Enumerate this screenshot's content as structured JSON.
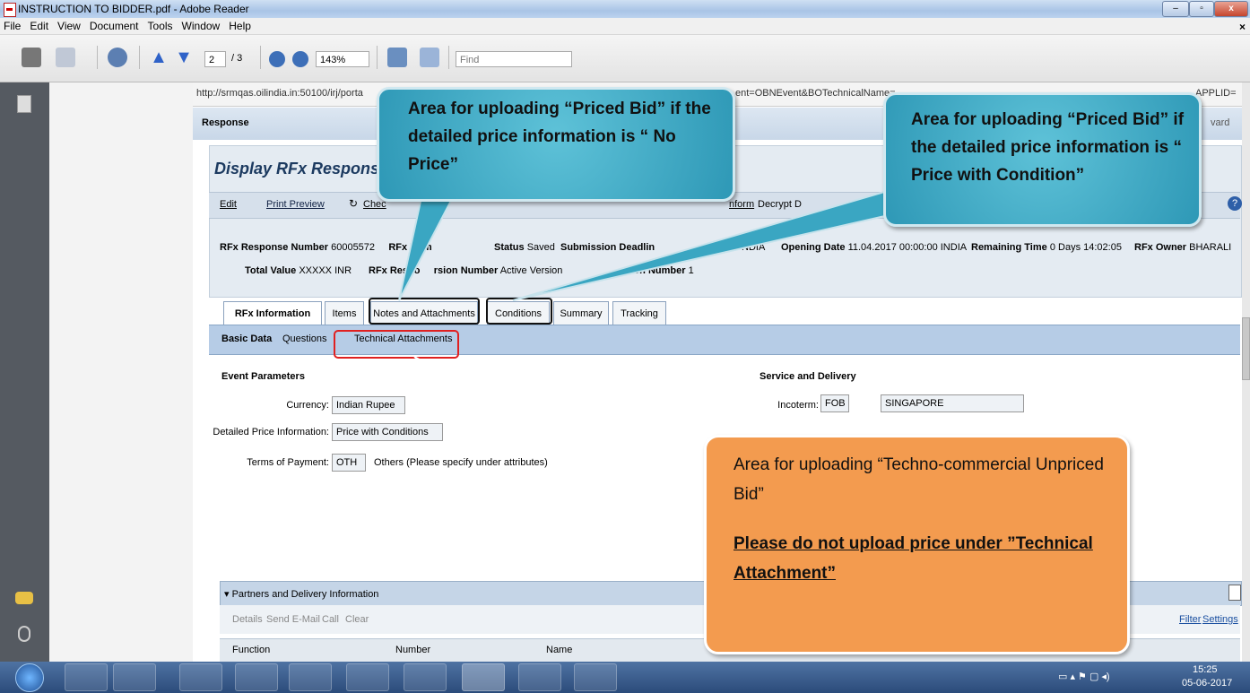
{
  "window": {
    "title": "INSTRUCTION TO BIDDER.pdf - Adobe Reader",
    "min": "–",
    "max": "▫",
    "close": "x"
  },
  "menu": [
    "File",
    "Edit",
    "View",
    "Document",
    "Tools",
    "Window",
    "Help"
  ],
  "menu_close": "×",
  "toolbar": {
    "page_current": "2",
    "page_total": "/ 3",
    "zoom": "143%",
    "find_placeholder": "Find"
  },
  "sap": {
    "url": "http://srmqas.oilindia.in:50100/irj/porta",
    "url_mid": "ent=OBNEvent&BOTechnicalName=",
    "url_right": "APPLID=",
    "response_label": "Response",
    "right_frag": "vard",
    "page_title": "Display RFx Response:",
    "toolbar": {
      "edit": "Edit",
      "print_preview": "Print Preview",
      "check": "Chec",
      "nform": "nform",
      "decrypt": "Decrypt D"
    },
    "header": {
      "response_number_label": "RFx Response Number",
      "response_number": "60005572",
      "rfx_num_label": "RFx Num",
      "status_label": "Status",
      "status": "Saved",
      "submission_label": "Submission Deadlin",
      "india_frag": "NDIA",
      "opening_label": "Opening Date",
      "opening": "11.04.2017 00:00:00 INDIA",
      "remaining_label": "Remaining Time",
      "remaining": "0 Days 14:02:05",
      "owner_label": "RFx Owner",
      "owner": "BHARALI",
      "total_label": "Total Value",
      "total": "XXXXX INR",
      "version_label_a": "RFx Respo",
      "version_label_b": "rsion Number",
      "version": "Active Version",
      "version_num_label": "rsion Number",
      "version_num": "1"
    },
    "tabs": [
      "RFx Information",
      "Items",
      "Notes and Attachments",
      "Conditions",
      "Summary",
      "Tracking"
    ],
    "subtabs": [
      "Basic Data",
      "Questions",
      "Technical Attachments"
    ],
    "event_params": {
      "title": "Event Parameters",
      "currency_label": "Currency:",
      "currency": "Indian Rupee",
      "price_info_label": "Detailed Price Information:",
      "price_info": "Price with Conditions",
      "payment_label": "Terms of Payment:",
      "payment_code": "OTH",
      "payment_text": "Others (Please specify under attributes)"
    },
    "service": {
      "title": "Service and Delivery",
      "incoterm_label": "Incoterm:",
      "incoterm_code": "FOB",
      "incoterm_place": "SINGAPORE"
    },
    "partners": {
      "title": "▾ Partners and Delivery Information",
      "actions": [
        "Details",
        "Send E-Mail",
        "Call",
        "Clear"
      ],
      "filter": "Filter",
      "settings": "Settings",
      "columns": [
        "Function",
        "Number",
        "Name"
      ]
    }
  },
  "callouts": {
    "no_price": "Area for uploading “Priced Bid” if the detailed price information is “ No Price”",
    "price_with_condition": "Area for uploading “Priced Bid” if the detailed price information is “ Price with Condition”",
    "techno_line1": "Area for uploading “Techno-commercial Unpriced Bid”",
    "techno_line2": "Please do not upload price under ”Technical Attachment”"
  },
  "clock": {
    "time": "15:25",
    "date": "05-06-2017"
  }
}
